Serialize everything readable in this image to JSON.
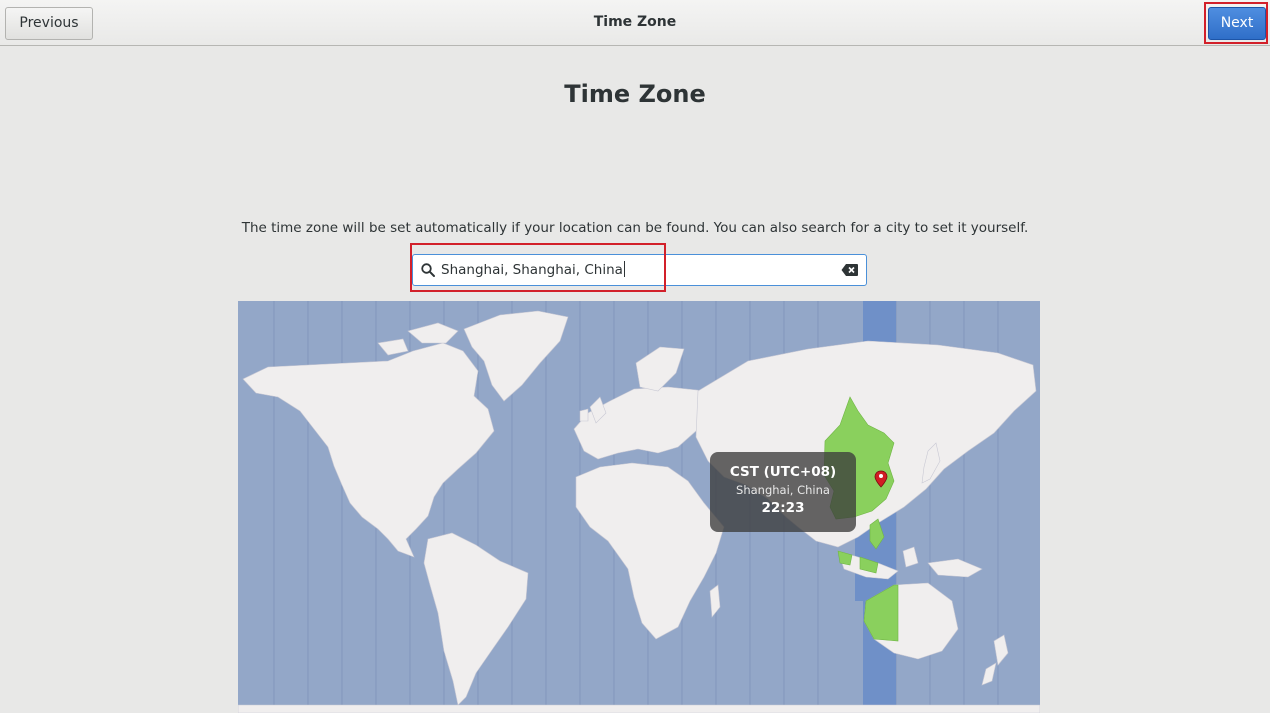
{
  "header": {
    "title": "Time Zone",
    "previous_label": "Previous",
    "next_label": "Next"
  },
  "page": {
    "title": "Time Zone",
    "description": "The time zone will be set automatically if your location can be found. You can also search for a city to set it yourself."
  },
  "search": {
    "value": "Shanghai, Shanghai, China",
    "icon": "search-icon",
    "clear_icon": "clear-icon"
  },
  "map": {
    "selected_zone_label": "CST (UTC+08)",
    "selected_city": "Shanghai, China",
    "local_time": "22:23",
    "marker_icon": "location-pin-icon"
  },
  "colors": {
    "accent": "#3572c9",
    "ocean": "#93a7c8",
    "land": "#f0eeee",
    "selected_zone": "#8ad05d",
    "selected_band": "#6f90c8",
    "highlight": "#d2202a"
  }
}
